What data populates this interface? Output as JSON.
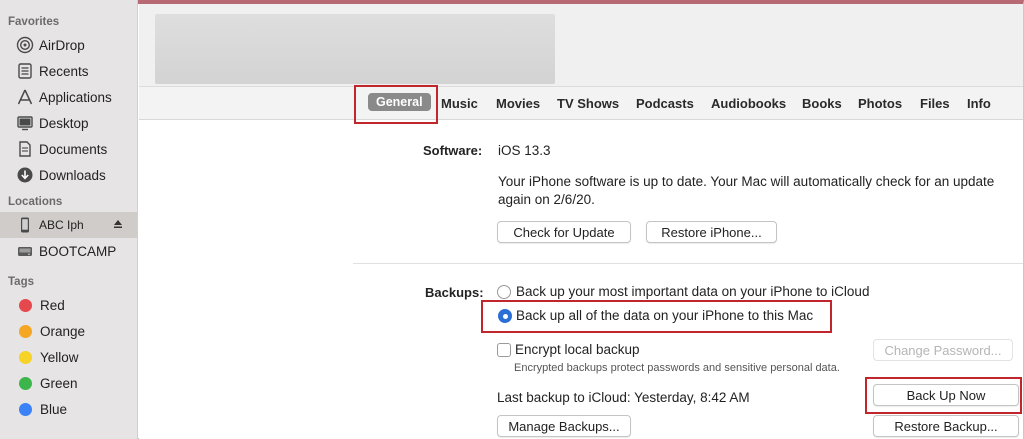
{
  "sidebar": {
    "favorites_title": "Favorites",
    "favorites": [
      {
        "label": "AirDrop",
        "icon": "airdrop-icon"
      },
      {
        "label": "Recents",
        "icon": "recents-icon"
      },
      {
        "label": "Applications",
        "icon": "applications-icon"
      },
      {
        "label": "Desktop",
        "icon": "desktop-icon"
      },
      {
        "label": "Documents",
        "icon": "documents-icon"
      },
      {
        "label": "Downloads",
        "icon": "downloads-icon"
      }
    ],
    "locations_title": "Locations",
    "locations": [
      {
        "label": "ABC Iph",
        "icon": "iphone-icon",
        "selected": true
      },
      {
        "label": "BOOTCAMP",
        "icon": "drive-icon"
      }
    ],
    "tags_title": "Tags",
    "tags": [
      {
        "label": "Red",
        "color": "#e5484d"
      },
      {
        "label": "Orange",
        "color": "#f5a623"
      },
      {
        "label": "Yellow",
        "color": "#f5d327"
      },
      {
        "label": "Green",
        "color": "#3cb64a"
      },
      {
        "label": "Blue",
        "color": "#3b82f6"
      }
    ]
  },
  "tabs": [
    "General",
    "Music",
    "Movies",
    "TV Shows",
    "Podcasts",
    "Audiobooks",
    "Books",
    "Photos",
    "Files",
    "Info"
  ],
  "software": {
    "label": "Software:",
    "version": "iOS 13.3",
    "status_line1": "Your iPhone software is up to date. Your Mac will automatically check for an update",
    "status_line2": "again on 2/6/20.",
    "check_button": "Check for Update",
    "restore_button": "Restore iPhone..."
  },
  "backups": {
    "label": "Backups:",
    "option_icloud": "Back up your most important data on your iPhone to iCloud",
    "option_mac": "Back up all of the data on your iPhone to this Mac",
    "encrypt_label": "Encrypt local backup",
    "encrypt_note": "Encrypted backups protect passwords and sensitive personal data.",
    "change_password_button": "Change Password...",
    "last_backup": "Last backup to iCloud:  Yesterday, 8:42 AM",
    "back_up_now_button": "Back Up Now",
    "manage_button": "Manage Backups...",
    "restore_backup_button": "Restore Backup..."
  },
  "colors": {
    "accent": "#2a6fd6",
    "highlight": "#c2262d"
  }
}
